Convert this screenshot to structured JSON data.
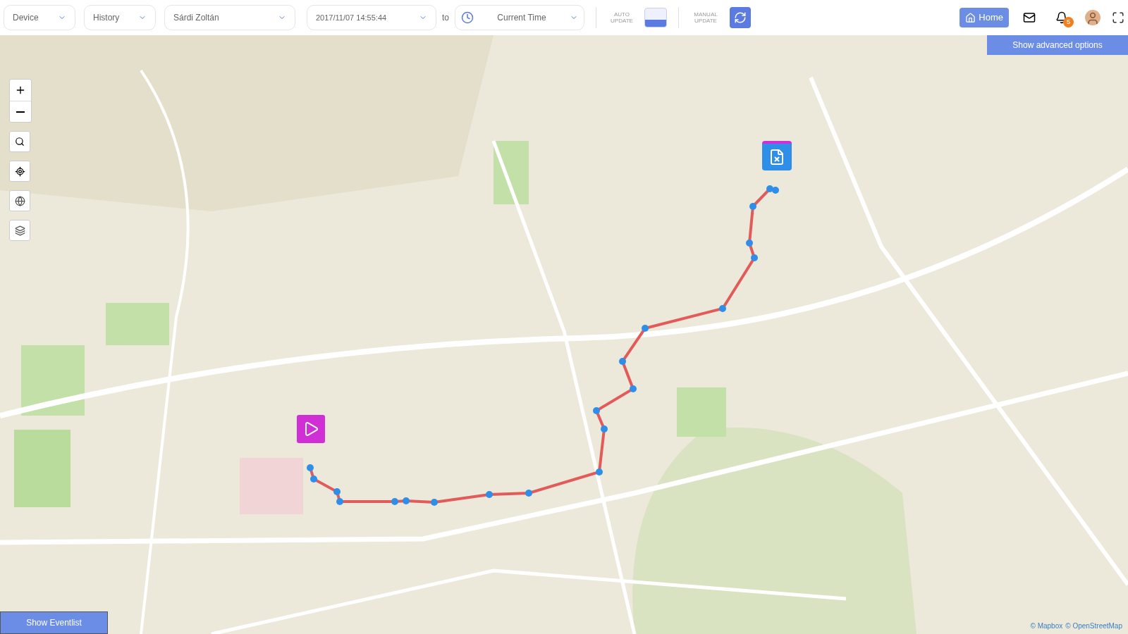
{
  "toolbar": {
    "selects": [
      {
        "kind": "select",
        "value": "Device"
      },
      {
        "kind": "select",
        "value": "History"
      },
      {
        "kind": "select",
        "value": "Sárdi Zoltán"
      }
    ],
    "range": {
      "from": "2017/11/07 14:55:44",
      "separator": "to",
      "until": "Current Time"
    },
    "auto_update": {
      "label": "AUTO UPDATE",
      "on": true
    },
    "manual_update": {
      "label": "MANUAL UPDATE"
    },
    "home_button": "Home",
    "notification_count": "5"
  },
  "advanced_options_button": "Show advanced options",
  "map": {
    "kind": "picture",
    "attribution": [
      "© Mapbox",
      "© OpenStreetMap"
    ]
  },
  "eventlist_button": "Show Eventlist"
}
